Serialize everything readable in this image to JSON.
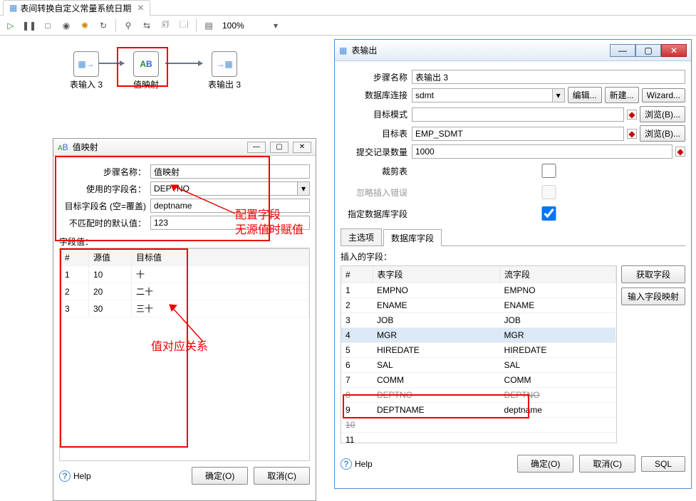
{
  "tab": {
    "title": "表间转换自定义常量系统日期"
  },
  "toolbar": {
    "zoom": "100%"
  },
  "flow": {
    "node_in": {
      "label": "表输入 3"
    },
    "node_map": {
      "label": "值映射"
    },
    "node_out": {
      "label": "表输出 3"
    }
  },
  "leftDialog": {
    "title": "值映射",
    "labels": {
      "stepName": "步骤名称：",
      "useField": "使用的字段名：",
      "targetField": "目标字段名 (空=覆盖)",
      "defaultVal": "不匹配时的默认值：",
      "gridSection": "字段值："
    },
    "values": {
      "stepName": "值映射",
      "useField": "DEPTNO",
      "targetField": "deptname",
      "defaultVal": "123"
    },
    "gridHeaders": {
      "idx": "#",
      "src": "源值",
      "tgt": "目标值"
    },
    "gridRows": [
      {
        "n": "1",
        "src": "10",
        "tgt": "十"
      },
      {
        "n": "2",
        "src": "20",
        "tgt": "二十"
      },
      {
        "n": "3",
        "src": "30",
        "tgt": "三十"
      }
    ],
    "buttons": {
      "ok": "确定(O)",
      "cancel": "取消(C)",
      "help": "Help"
    }
  },
  "rightWindow": {
    "title": "表输出",
    "labels": {
      "stepName": "步骤名称",
      "dbConn": "数据库连接",
      "schema": "目标模式",
      "table": "目标表",
      "commit": "提交记录数量",
      "truncate": "裁剪表",
      "ignore": "忽略插入错误",
      "specify": "指定数据库字段"
    },
    "values": {
      "stepName": "表输出 3",
      "dbConn": "sdmt",
      "schema": "",
      "table": "EMP_SDMT",
      "commit": "1000",
      "truncate": false,
      "ignore": false,
      "specify": true
    },
    "sideButtons": {
      "edit": "编辑...",
      "new": "新建...",
      "wizard": "Wizard...",
      "browse": "浏览(B)...",
      "getFields": "获取字段",
      "inputMap": "输入字段映射"
    },
    "tabs": {
      "main": "主选项",
      "fields": "数据库字段"
    },
    "insertLabel": "插入的字段：",
    "gridHeaders": {
      "idx": "#",
      "tableField": "表字段",
      "streamField": "流字段"
    },
    "gridRows": [
      {
        "n": "1",
        "t": "EMPNO",
        "s": "EMPNO"
      },
      {
        "n": "2",
        "t": "ENAME",
        "s": "ENAME"
      },
      {
        "n": "3",
        "t": "JOB",
        "s": "JOB"
      },
      {
        "n": "4",
        "t": "MGR",
        "s": "MGR",
        "sel": true
      },
      {
        "n": "5",
        "t": "HIREDATE",
        "s": "HIREDATE"
      },
      {
        "n": "6",
        "t": "SAL",
        "s": "SAL"
      },
      {
        "n": "7",
        "t": "COMM",
        "s": "COMM"
      },
      {
        "n": "8",
        "t": "DEPTNO",
        "s": "DEPTNO",
        "strike": true
      },
      {
        "n": "9",
        "t": "DEPTNAME",
        "s": "deptname",
        "hl": true
      },
      {
        "n": "10",
        "t": "",
        "s": "",
        "strike": true
      },
      {
        "n": "11",
        "t": "",
        "s": ""
      }
    ],
    "buttons": {
      "ok": "确定(O)",
      "cancel": "取消(C)",
      "sql": "SQL",
      "help": "Help"
    }
  },
  "annotations": {
    "a1": "配置字段\n无源值时赋值",
    "a2": "值对应关系"
  }
}
